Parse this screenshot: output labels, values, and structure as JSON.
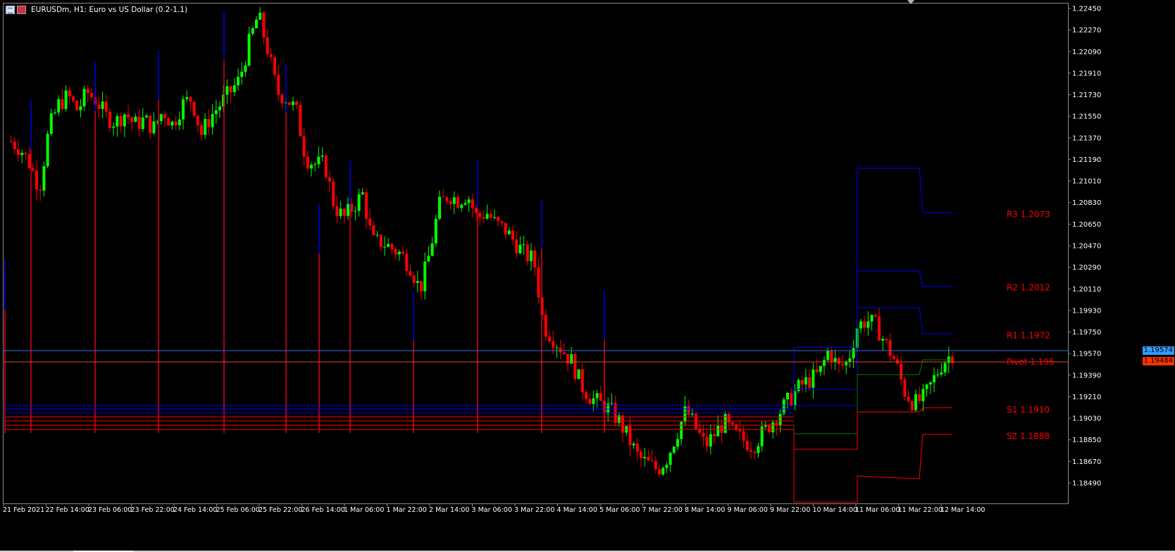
{
  "window": {
    "title": "EURUSDm, H1:  Euro vs US Dollar (0.2-1.1)"
  },
  "chart_data": {
    "type": "candlestick",
    "symbol": "EURUSDm",
    "timeframe": "H1",
    "y_ticks": [
      "1.22450",
      "1.22270",
      "1.22090",
      "1.21910",
      "1.21730",
      "1.21550",
      "1.21370",
      "1.21190",
      "1.21010",
      "1.20830",
      "1.20650",
      "1.20470",
      "1.20290",
      "1.20110",
      "1.19930",
      "1.19750",
      "1.19570",
      "1.19390",
      "1.19210",
      "1.19030",
      "1.18850",
      "1.18670",
      "1.18490"
    ],
    "ylim": [
      1.1838,
      1.2248
    ],
    "x_ticks": [
      "21 Feb 2021",
      "22 Feb 14:00",
      "23 Feb 06:00",
      "23 Feb 22:00",
      "24 Feb 14:00",
      "25 Feb 06:00",
      "25 Feb 22:00",
      "26 Feb 14:00",
      "1 Mar 06:00",
      "1 Mar 22:00",
      "2 Mar 14:00",
      "3 Mar 06:00",
      "3 Mar 22:00",
      "4 Mar 14:00",
      "5 Mar 06:00",
      "7 Mar 22:00",
      "8 Mar 14:00",
      "9 Mar 06:00",
      "9 Mar 22:00",
      "10 Mar 14:00",
      "11 Mar 06:00",
      "11 Mar 22:00",
      "12 Mar 14:00"
    ],
    "bid_price": "1.19574",
    "ask_price": "1.19484",
    "levels": [
      {
        "label": "R3 1.2073",
        "value": 1.2073
      },
      {
        "label": "R2 1.2012",
        "value": 1.2012
      },
      {
        "label": "R1 1.1972",
        "value": 1.1972
      },
      {
        "label": "Pivot 1.195",
        "value": 1.195
      },
      {
        "label": "S1 1.1910",
        "value": 1.191
      },
      {
        "label": "S2 1.1888",
        "value": 1.1888
      }
    ],
    "price_path": [
      1.2134,
      1.2128,
      1.2115,
      1.2095,
      1.2145,
      1.2165,
      1.2172,
      1.216,
      1.2175,
      1.2168,
      1.2155,
      1.215,
      1.2158,
      1.2148,
      1.2152,
      1.2145,
      1.216,
      1.2148,
      1.2165,
      1.217,
      1.214,
      1.2155,
      1.2165,
      1.2175,
      1.2185,
      1.2215,
      1.224,
      1.221,
      1.2175,
      1.217,
      1.216,
      1.212,
      1.2115,
      1.2115,
      1.208,
      1.207,
      1.208,
      1.209,
      1.205,
      1.205,
      1.2045,
      1.204,
      1.203,
      1.201,
      1.204,
      1.208,
      1.209,
      1.2085,
      1.209,
      1.207,
      1.2075,
      1.2065,
      1.206,
      1.205,
      1.204,
      1.2035,
      1.198,
      1.197,
      1.196,
      1.195,
      1.193,
      1.192,
      1.1915,
      1.191,
      1.19,
      1.1885,
      1.187,
      1.1865,
      1.186,
      1.187,
      1.189,
      1.191,
      1.1895,
      1.188,
      1.189,
      1.19,
      1.189,
      1.1885,
      1.188,
      1.189,
      1.19,
      1.191,
      1.192,
      1.193,
      1.1935,
      1.194,
      1.196,
      1.1945,
      1.195,
      1.198,
      1.1985,
      1.198,
      1.1965,
      1.195,
      1.1925,
      1.1915,
      1.192,
      1.1935,
      1.195,
      1.1957
    ]
  },
  "colors": {
    "background": "#000000",
    "bull": "#00ff00",
    "bear": "#ff0000",
    "blue_line": "#0000ff",
    "red_line": "#ff0000",
    "green_line": "#008000",
    "axis_text": "#ffffff",
    "level_label": "#ff0000",
    "bid_tag": "#3399ff",
    "ask_tag": "#ff3300"
  },
  "icons": [
    "chart-window-icon",
    "symbol-flag-icon"
  ]
}
